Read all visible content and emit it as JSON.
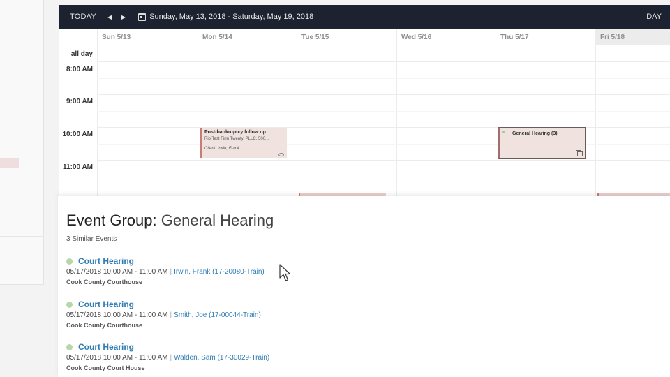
{
  "toolbar": {
    "today_label": "TODAY",
    "prev_icon": "caret-left-icon",
    "next_icon": "caret-right-icon",
    "calendar_icon": "calendar-icon",
    "date_range": "Sunday, May 13, 2018 - Saturday, May 19, 2018",
    "view_label": "DAY"
  },
  "columns": [
    "Sun 5/13",
    "Mon 5/14",
    "Tue 5/15",
    "Wed 5/16",
    "Thu 5/17",
    "Fri 5/18"
  ],
  "all_day_label": "all day",
  "time_labels": [
    "8:00 AM",
    "9:00 AM",
    "10:00 AM",
    "11:00 AM"
  ],
  "events": {
    "mon": {
      "title": "Post-bankruptcy follow up",
      "subtitle": "Rio Test Firm Twenty, PLLC, 500...",
      "client": "Client: Irwin, Frank"
    },
    "thu": {
      "title": "General Hearing (3)"
    }
  },
  "popup": {
    "title_label": "Event Group:",
    "title_value": "General Hearing",
    "count": "3 Similar Events",
    "items": [
      {
        "name": "Court Hearing",
        "datetime": "05/17/2018 10:00 AM - 11:00 AM",
        "separator": "|",
        "client": "Irwin, Frank (17-20080-Train)",
        "location": "Cook County Courthouse"
      },
      {
        "name": "Court Hearing",
        "datetime": "05/17/2018 10:00 AM - 11:00 AM",
        "separator": "|",
        "client": "Smith, Joe (17-00044-Train)",
        "location": "Cook County Courthouse"
      },
      {
        "name": "Court Hearing",
        "datetime": "05/17/2018 10:00 AM - 11:00 AM",
        "separator": "|",
        "client": "Walden, Sam (17-30029-Train)",
        "location": "Cook County Court House"
      }
    ]
  },
  "colors": {
    "toolbar_bg": "#1c2230",
    "event_bg": "#efe2df",
    "event_accent": "#c97b78",
    "link": "#2e7cb5",
    "status_dot": "#b9d6a9"
  }
}
